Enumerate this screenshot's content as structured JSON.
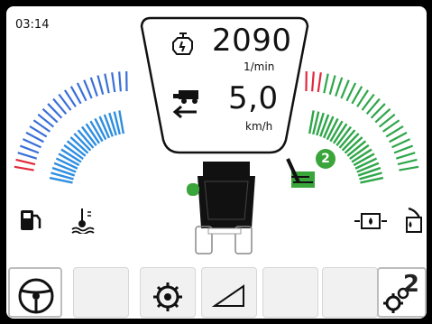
{
  "status": {
    "time": "03:14"
  },
  "engine": {
    "speed_value": "2090",
    "speed_unit": "1/min",
    "icon": "engine-icon"
  },
  "travel": {
    "speed_value": "5,0",
    "speed_unit": "km/h",
    "icon": "combine-reverse-icon"
  },
  "gauges": {
    "left_outer": {
      "icon": "fuel-pump-icon",
      "color": "#3a6fd8",
      "warn_color": "#e02a3c"
    },
    "left_inner": {
      "icon": "coolant-temperature-icon",
      "color": "#2f8ee0"
    },
    "right_inner": {
      "icon": "engine-oil-pressure-icon",
      "color": "#2fa64a"
    },
    "right_outer": {
      "icon": "hydraulic-oil-icon",
      "color": "#2fa64a",
      "warn_color": "#e02a3c"
    }
  },
  "work_mode": {
    "count": "2",
    "icon": "header-mode-icon",
    "badge_color": "#3aa53a"
  },
  "softkeys": [
    {
      "icon": "steering-wheel-icon",
      "label": ""
    },
    {
      "icon": "",
      "label": ""
    },
    {
      "icon": "rotor-icon",
      "label": ""
    },
    {
      "icon": "ramp-icon",
      "label": ""
    },
    {
      "icon": "",
      "label": ""
    },
    {
      "icon": "",
      "label": ""
    },
    {
      "icon": "gears-icon",
      "label": "2"
    }
  ]
}
